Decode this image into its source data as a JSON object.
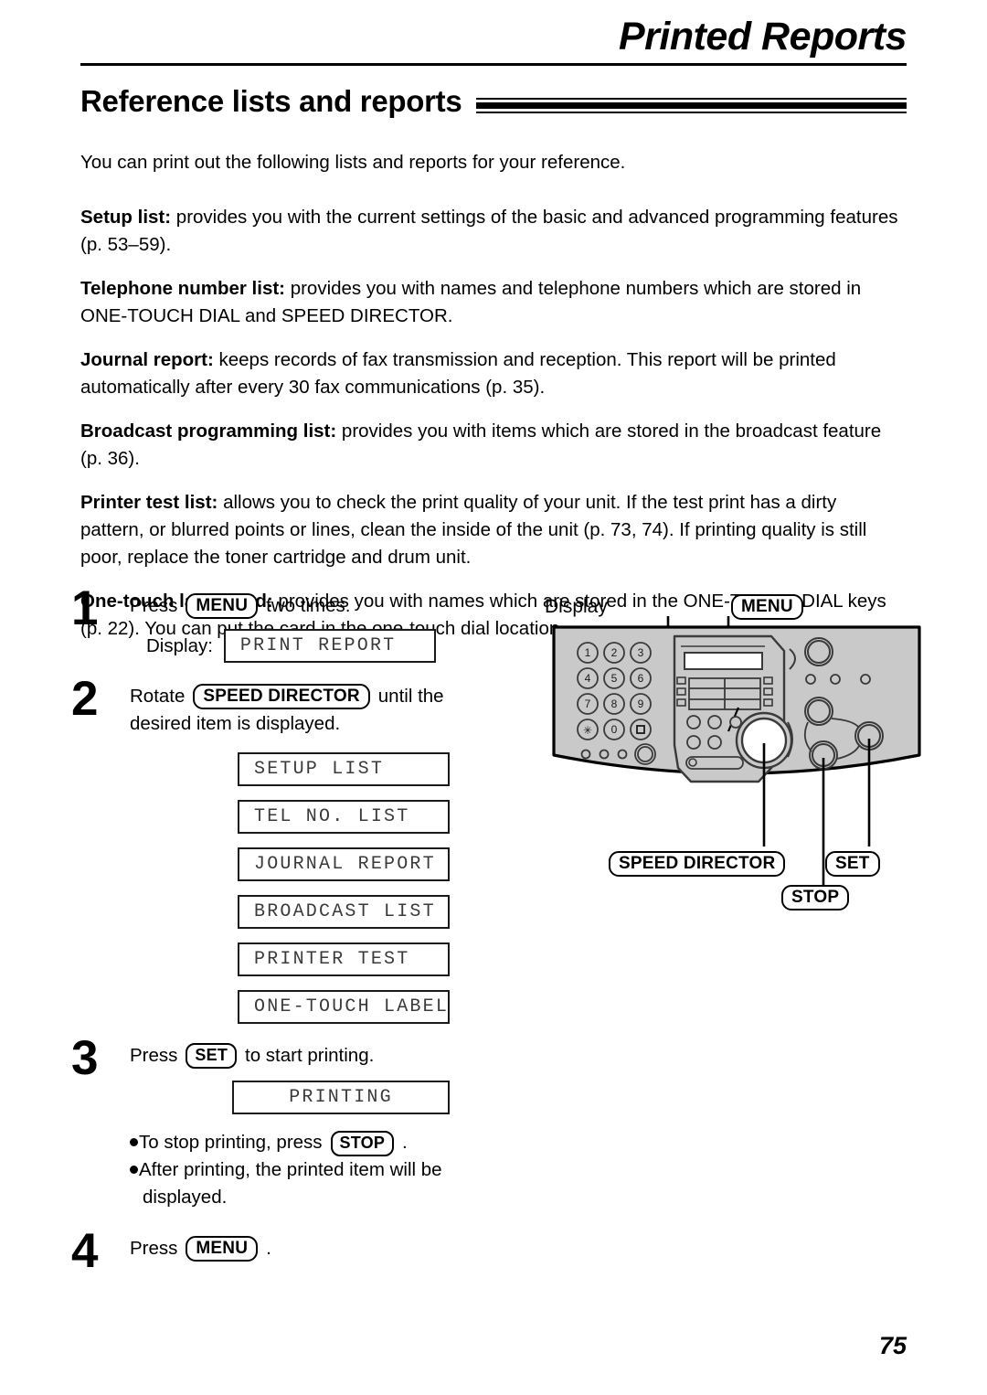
{
  "header": {
    "chapter_title": "Printed Reports",
    "section_title": "Reference lists and reports"
  },
  "prose": {
    "intro": "You can print out the following lists and reports for your reference.",
    "items": [
      {
        "term": "Setup list:",
        "text": " provides you with the current settings of the basic and advanced programming features (p. 53–59)."
      },
      {
        "term": "Telephone number list:",
        "text": " provides you with names and telephone numbers which are stored in ONE-TOUCH DIAL and SPEED DIRECTOR."
      },
      {
        "term": "Journal report:",
        "text": " keeps records of fax transmission and reception. This report will be printed automatically after every 30 fax communications (p. 35)."
      },
      {
        "term": "Broadcast programming list:",
        "text": " provides you with items which are stored in the broadcast feature (p. 36)."
      },
      {
        "term": "Printer test list:",
        "text": " allows you to check the print quality of your unit. If the test print has a dirty pattern, or blurred points or lines, clean the inside of the unit (p. 73, 74). If printing quality is still poor, replace the toner cartridge and drum unit."
      },
      {
        "term": "One-touch label card:",
        "text": " provides you with names which are stored in the ONE-TOUCH DIAL keys (p. 22). You can put the card in the one-touch dial location."
      }
    ]
  },
  "steps": {
    "step1": {
      "number": "1",
      "text_before": "Press",
      "key": "MENU",
      "text_after": "two times.",
      "display_label": "Display:",
      "display_value": "PRINT REPORT"
    },
    "step2": {
      "number": "2",
      "text_before": "Rotate",
      "key": "SPEED DIRECTOR",
      "text_after": "until the",
      "text_line2": "desired item is displayed.",
      "display_values": [
        "SETUP LIST",
        "TEL NO. LIST",
        "JOURNAL REPORT",
        "BROADCAST LIST",
        "PRINTER TEST",
        "ONE-TOUCH LABEL"
      ]
    },
    "step3": {
      "number": "3",
      "text_before": "Press",
      "key": "SET",
      "text_after": "to start printing.",
      "display_value": "PRINTING",
      "bullet1_before": "To stop printing, press",
      "bullet1_key": "STOP",
      "bullet1_after": ".",
      "bullet2_line1": "After printing, the printed item will be",
      "bullet2_line2": "displayed."
    },
    "step4": {
      "number": "4",
      "text_before": "Press",
      "key": "MENU",
      "text_after": "."
    }
  },
  "diagram": {
    "label_display": "Display",
    "key_menu": "MENU",
    "key_speed_director": "SPEED DIRECTOR",
    "key_stop": "STOP",
    "key_set": "SET",
    "keypad": [
      "1",
      "2",
      "3",
      "4",
      "5",
      "6",
      "7",
      "8",
      "9",
      "∗",
      "0",
      "■"
    ],
    "panel_color": "#c9c9c9",
    "panel_outline": "#000000"
  },
  "footer": {
    "page_number": "75"
  }
}
